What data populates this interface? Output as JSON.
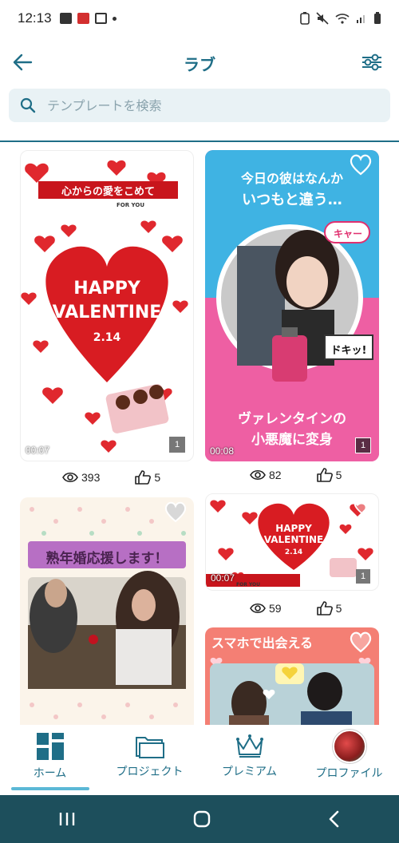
{
  "status_bar": {
    "time": "12:13"
  },
  "app_bar": {
    "title": "ラブ"
  },
  "search": {
    "placeholder": "テンプレートを検索"
  },
  "cards": [
    {
      "headline": "心からの愛をこめて",
      "sub": "FOR YOU",
      "main_line1": "HAPPY",
      "main_line2": "VALENTINE",
      "date": "2.14",
      "duration": "00:07",
      "badge": "1",
      "views": "393",
      "likes": "5"
    },
    {
      "headline_line1": "今日の彼はなんか",
      "headline_line2": "いつもと違う…",
      "bubble1": "キャー",
      "bubble2": "ドキッ!",
      "bottom_line1": "ヴァレンタインの",
      "bottom_line2": "小悪魔に変身",
      "duration": "00:08",
      "badge": "1",
      "views": "82",
      "likes": "5"
    },
    {
      "headline": "熟年婚応援します！"
    },
    {
      "main_line1": "HAPPY",
      "main_line2": "VALENTINE",
      "date": "2.14",
      "sub": "FOR YOU",
      "duration": "00:07",
      "badge": "1",
      "views": "59",
      "likes": "5"
    },
    {
      "headline": "スマホで出会える"
    }
  ],
  "bottom_nav": {
    "home": "ホーム",
    "projects": "プロジェクト",
    "premium": "プレミアム",
    "profile": "プロファイル"
  },
  "colors": {
    "accent": "#1f6e87",
    "indicator": "#5bb8d6",
    "sys_nav": "#1d4f5c",
    "valentine_red": "#e0282e"
  }
}
